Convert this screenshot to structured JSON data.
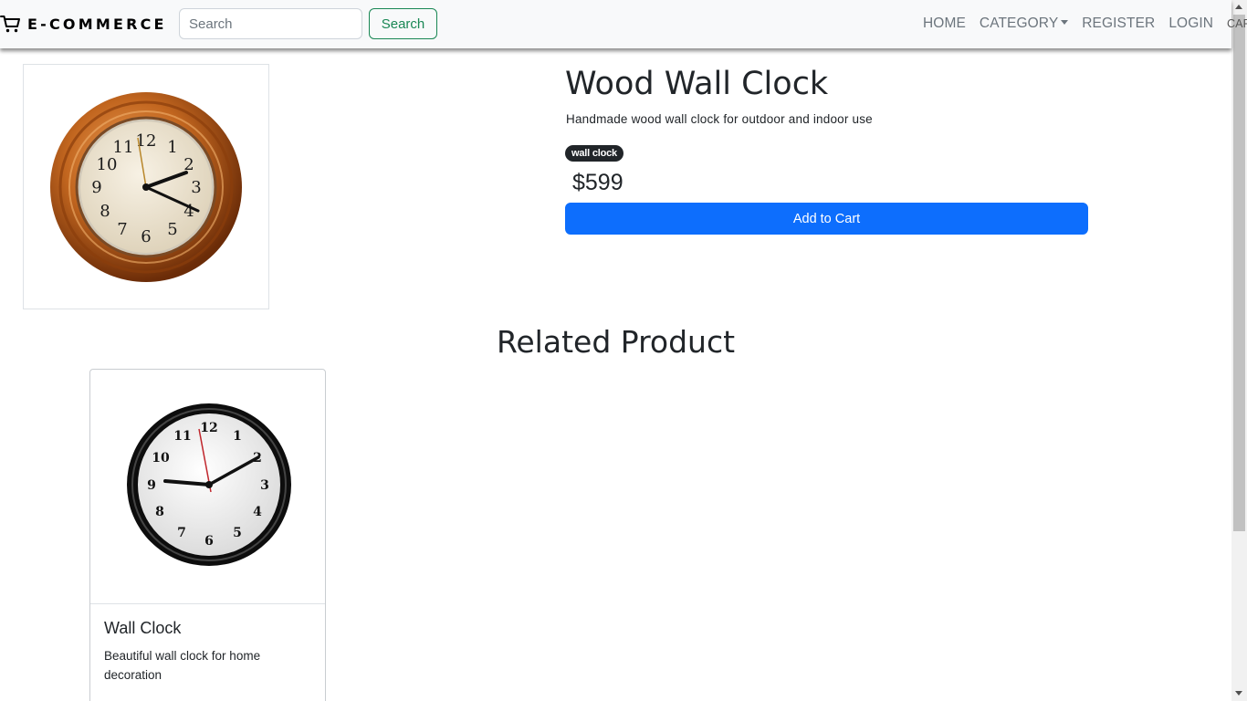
{
  "brand": {
    "name": "E-COMMERCE",
    "icon": "cart-icon"
  },
  "search": {
    "placeholder": "Search",
    "value": "",
    "button_label": "Search"
  },
  "nav": {
    "home": "HOME",
    "category": "CATEGORY",
    "register": "REGISTER",
    "login": "LOGIN",
    "cart": "CART"
  },
  "product": {
    "title": "Wood Wall Clock",
    "description": "Handmade wood wall clock for outdoor and indoor use",
    "category_badge": "wall clock",
    "price": "$599",
    "add_to_cart_label": "Add to Cart",
    "image": "wood-wall-clock-image"
  },
  "related": {
    "heading": "Related Product",
    "items": [
      {
        "title": "Wall Clock",
        "description": "Beautiful wall clock for home decoration",
        "image": "wall-clock-image"
      }
    ]
  },
  "colors": {
    "primary": "#0d6efd",
    "success": "#198754",
    "navbar_bg": "#f8f9fa",
    "badge_bg": "#212529"
  }
}
